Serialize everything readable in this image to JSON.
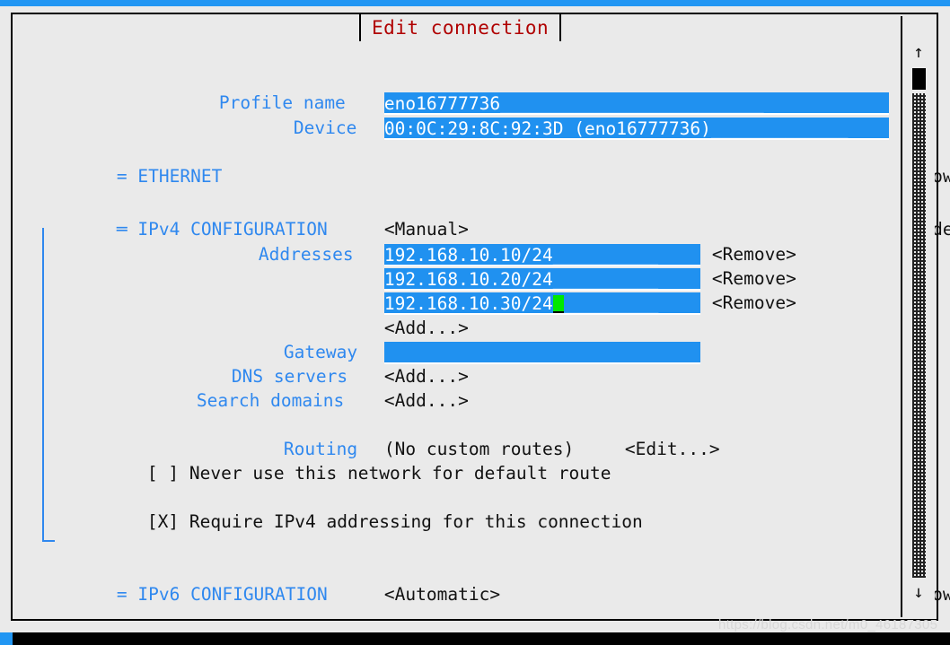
{
  "window": {
    "title": "Edit connection",
    "title_color": "#b00000",
    "frame_color": "#000000",
    "background": "#eaeaea"
  },
  "colors": {
    "label_blue": "#2f88ef",
    "field_blue": "#2091f0",
    "field_text": "#ffffff",
    "cursor_green": "#00e800",
    "body_text": "#111111",
    "top_strip_blue": "#2196f3"
  },
  "form": {
    "profile_name": {
      "label": "Profile name",
      "value": "eno16777736",
      "fill": "_________________________",
      "placeholder": ""
    },
    "device": {
      "label": "Device",
      "value": "00:0C:29:8C:92:3D (eno16777736)",
      "fill": "_____________",
      "placeholder": ""
    }
  },
  "sections": [
    {
      "marker": "=",
      "name": "ETHERNET",
      "toggle": "<Show>",
      "expanded": false
    },
    {
      "marker": "═",
      "name": "IPv4 CONFIGURATION",
      "mode": "<Manual>",
      "toggle": "<Hide>",
      "expanded": true
    },
    {
      "marker": "=",
      "name": "IPv6 CONFIGURATION",
      "mode": "<Automatic>",
      "toggle": "<Show>",
      "expanded": false
    }
  ],
  "ipv4": {
    "addresses_label": "Addresses",
    "addresses": [
      {
        "value": "192.168.10.10/24",
        "fill": "__________",
        "remove_label": "<Remove>",
        "cursor": false
      },
      {
        "value": "192.168.10.20/24",
        "fill": "__________",
        "remove_label": "<Remove>",
        "cursor": false
      },
      {
        "value": "192.168.10.30/24",
        "fill": "_________",
        "remove_label": "<Remove>",
        "cursor": true
      }
    ],
    "address_add_label": "<Add...>",
    "gateway": {
      "label": "Gateway",
      "value": "",
      "fill": "                           "
    },
    "dns_servers": {
      "label": "DNS servers",
      "add_label": "<Add...>"
    },
    "search_domains": {
      "label": "Search domains",
      "add_label": "<Add...>"
    },
    "routing": {
      "label": "Routing",
      "status": "(No custom routes)",
      "edit_label": "<Edit...>"
    },
    "never_default": {
      "checkbox": "[ ]",
      "checked": false,
      "label": "Never use this network for default route"
    },
    "require_ipv4": {
      "checkbox": "[X]",
      "checked": true,
      "label": "Require IPv4 addressing for this connection"
    }
  },
  "scrollbar": {
    "up_arrow": "↑",
    "down_arrow": "↓"
  },
  "watermark": {
    "text": "https://blog.csdn.net/m0_46187305"
  }
}
